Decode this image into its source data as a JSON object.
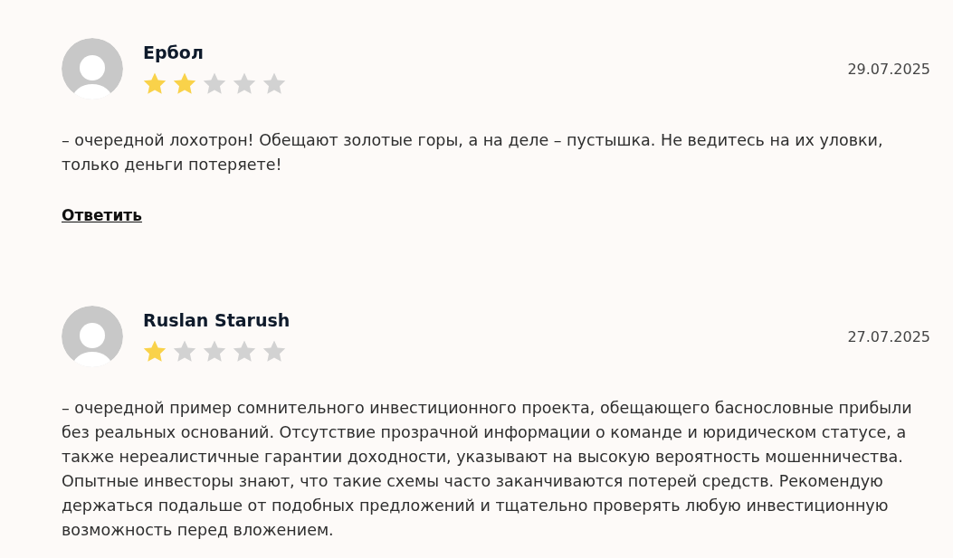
{
  "reviews": [
    {
      "author": "Ербол",
      "stars": 2,
      "date": "29.07.2025",
      "text": "– очередной лохотрон! Обещают золотые горы, а на деле – пустышка. Не ведитесь на их уловки, только деньги потеряете!",
      "reply": "Ответить"
    },
    {
      "author": "Ruslan Starush",
      "stars": 1,
      "date": "27.07.2025",
      "text": "– очередной пример сомнительного инвестиционного проекта, обещающего баснословные прибыли без реальных оснований. Отсутствие прозрачной информации о команде и юридическом статусе, а также нереалистичные гарантии доходности, указывают на высокую вероятность мошенничества. Опытные инвесторы знают, что такие схемы часто заканчиваются потерей средств. Рекомендую держаться подальше от подобных предложений и тщательно проверять любую инвестиционную возможность перед вложением."
    }
  ]
}
